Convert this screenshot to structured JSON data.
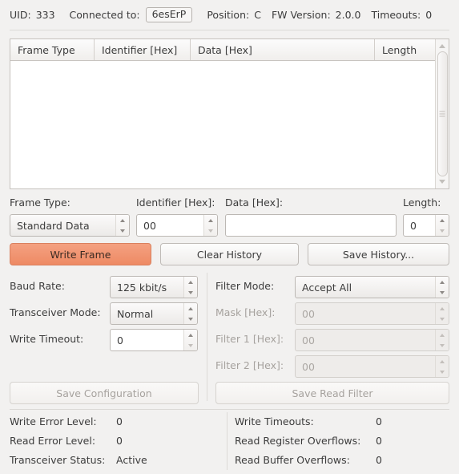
{
  "statusbar": {
    "uid_label": "UID:",
    "uid_value": "333",
    "connected_label": "Connected to:",
    "connected_value": "6esErP",
    "position_label": "Position:",
    "position_value": "C",
    "fw_label": "FW Version:",
    "fw_value": "2.0.0",
    "timeouts_label": "Timeouts:",
    "timeouts_value": "0"
  },
  "history_table": {
    "columns": [
      "Frame Type",
      "Identifier [Hex]",
      "Data [Hex]",
      "Length"
    ],
    "rows": []
  },
  "frame_entry": {
    "frame_type_label": "Frame Type:",
    "frame_type_value": "Standard Data",
    "identifier_label": "Identifier [Hex]:",
    "identifier_value": "00",
    "data_label": "Data [Hex]:",
    "data_value": "",
    "length_label": "Length:",
    "length_value": "0"
  },
  "actions": {
    "write_frame": "Write Frame",
    "clear_history": "Clear History",
    "save_history": "Save History..."
  },
  "configuration": {
    "baud_rate_label": "Baud Rate:",
    "baud_rate_value": "125 kbit/s",
    "transceiver_mode_label": "Transceiver Mode:",
    "transceiver_mode_value": "Normal",
    "write_timeout_label": "Write Timeout:",
    "write_timeout_value": "0",
    "save_configuration": "Save Configuration"
  },
  "read_filter": {
    "filter_mode_label": "Filter Mode:",
    "filter_mode_value": "Accept All",
    "mask_label": "Mask [Hex]:",
    "mask_value": "00",
    "filter1_label": "Filter 1 [Hex]:",
    "filter1_value": "00",
    "filter2_label": "Filter 2 [Hex]:",
    "filter2_value": "00",
    "save_read_filter": "Save Read Filter"
  },
  "stats_left": {
    "write_error_label": "Write Error Level:",
    "write_error_value": "0",
    "read_error_label": "Read Error Level:",
    "read_error_value": "0",
    "transceiver_status_label": "Transceiver Status:",
    "transceiver_status_value": "Active"
  },
  "stats_right": {
    "write_timeouts_label": "Write Timeouts:",
    "write_timeouts_value": "0",
    "read_register_overflows_label": "Read Register Overflows:",
    "read_register_overflows_value": "0",
    "read_buffer_overflows_label": "Read Buffer Overflows:",
    "read_buffer_overflows_value": "0"
  },
  "colors": {
    "accent": "#ee8a64",
    "background": "#f2f1f0",
    "text": "#3c3c3c",
    "disabled_text": "#a6a29e"
  }
}
